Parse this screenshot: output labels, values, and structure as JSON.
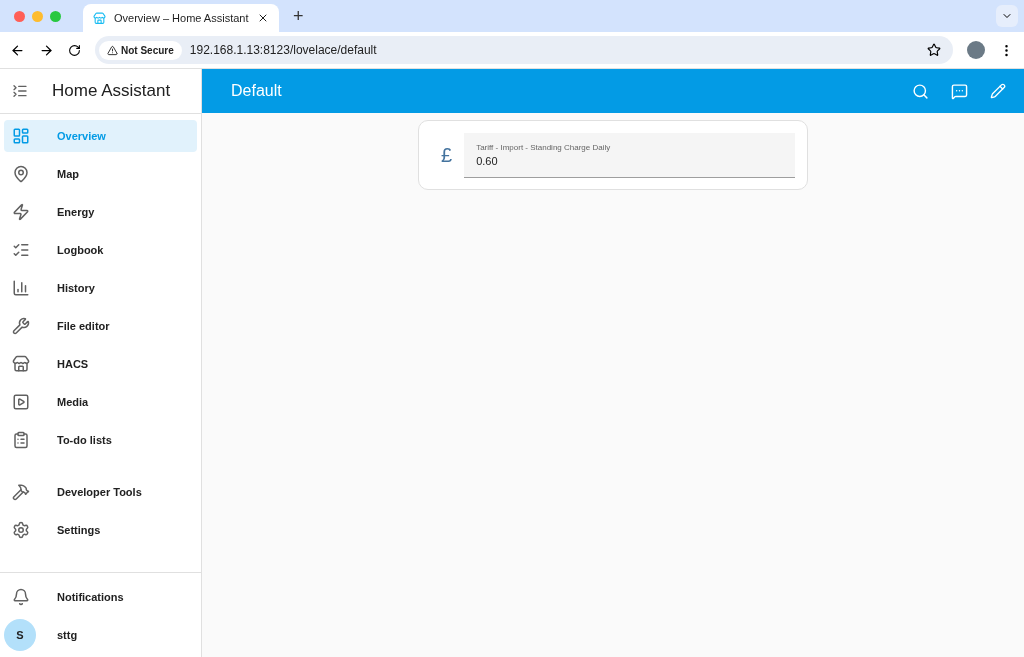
{
  "browser": {
    "tab_title": "Overview – Home Assistant",
    "new_tab": "+",
    "security": "Not Secure",
    "url": "192.168.1.13:8123/lovelace/default"
  },
  "sidebar": {
    "title": "Home Assistant",
    "items": [
      {
        "label": "Overview",
        "kind": "dashboard",
        "selected": true
      },
      {
        "label": "Map",
        "kind": "map",
        "selected": false
      },
      {
        "label": "Energy",
        "kind": "energy",
        "selected": false
      },
      {
        "label": "Logbook",
        "kind": "list",
        "selected": false
      },
      {
        "label": "History",
        "kind": "chart",
        "selected": false
      },
      {
        "label": "File editor",
        "kind": "wrench",
        "selected": false
      },
      {
        "label": "HACS",
        "kind": "store",
        "selected": false
      },
      {
        "label": "Media",
        "kind": "media",
        "selected": false
      },
      {
        "label": "To-do lists",
        "kind": "todo",
        "selected": false
      }
    ],
    "tools": [
      {
        "label": "Developer Tools",
        "kind": "hammer",
        "selected": false
      },
      {
        "label": "Settings",
        "kind": "gear",
        "selected": false
      }
    ],
    "notifications": "Notifications",
    "user": {
      "initial": "S",
      "name": "sttg"
    }
  },
  "header": {
    "title": "Default"
  },
  "card": {
    "icon_glyph": "£",
    "label": "Tariff - Import - Standing Charge Daily",
    "value": "0.60"
  }
}
